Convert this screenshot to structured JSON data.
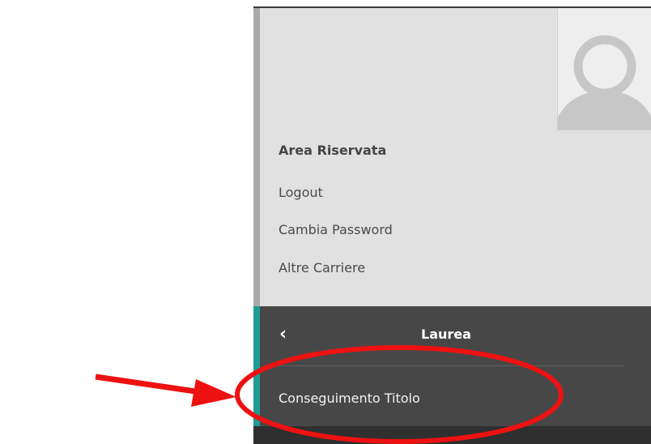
{
  "area_riservata": {
    "title": "Area Riservata",
    "links": {
      "logout": "Logout",
      "change_password": "Cambia Password",
      "other_careers": "Altre Carriere"
    }
  },
  "nav": {
    "back_icon": "chevron-left-icon",
    "back_glyph": "‹",
    "title": "Laurea",
    "items": [
      "Conseguimento Titolo"
    ]
  },
  "colors": {
    "panel_bg": "#e1e1e1",
    "nav_bg": "#474747",
    "accent": "#1e9b95",
    "annotation": "#ee1111"
  }
}
